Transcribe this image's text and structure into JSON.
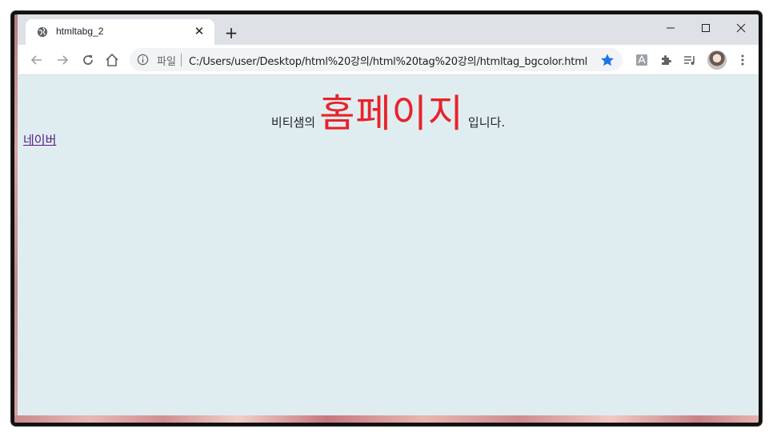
{
  "browser": {
    "tab_title": "htmltabg_2",
    "tab_close": "✕",
    "new_tab": "+",
    "omnibox": {
      "scheme_label": "파일",
      "url": "C:/Users/user/Desktop/html%20강의/html%20tag%20강의/htmltag_bgcolor.html"
    },
    "icons": [
      "globe-icon",
      "close-icon",
      "plus-icon",
      "minimize-icon",
      "maximize-icon",
      "window-close-icon",
      "back-arrow-icon",
      "forward-arrow-icon",
      "reload-icon",
      "home-icon",
      "info-icon",
      "star-icon",
      "pdf-extension-icon",
      "puzzle-icon",
      "media-queue-icon",
      "avatar",
      "more-vert-icon"
    ],
    "colors": {
      "accent_star": "#1a73e8",
      "page_background": "#e0edf0",
      "highlight_text": "#e8232a",
      "visited_link": "#551a8b"
    }
  },
  "page": {
    "heading_prefix": "비티샘의",
    "heading_big": "홈페이지",
    "heading_suffix": "입니다.",
    "link_text": "네이버"
  }
}
